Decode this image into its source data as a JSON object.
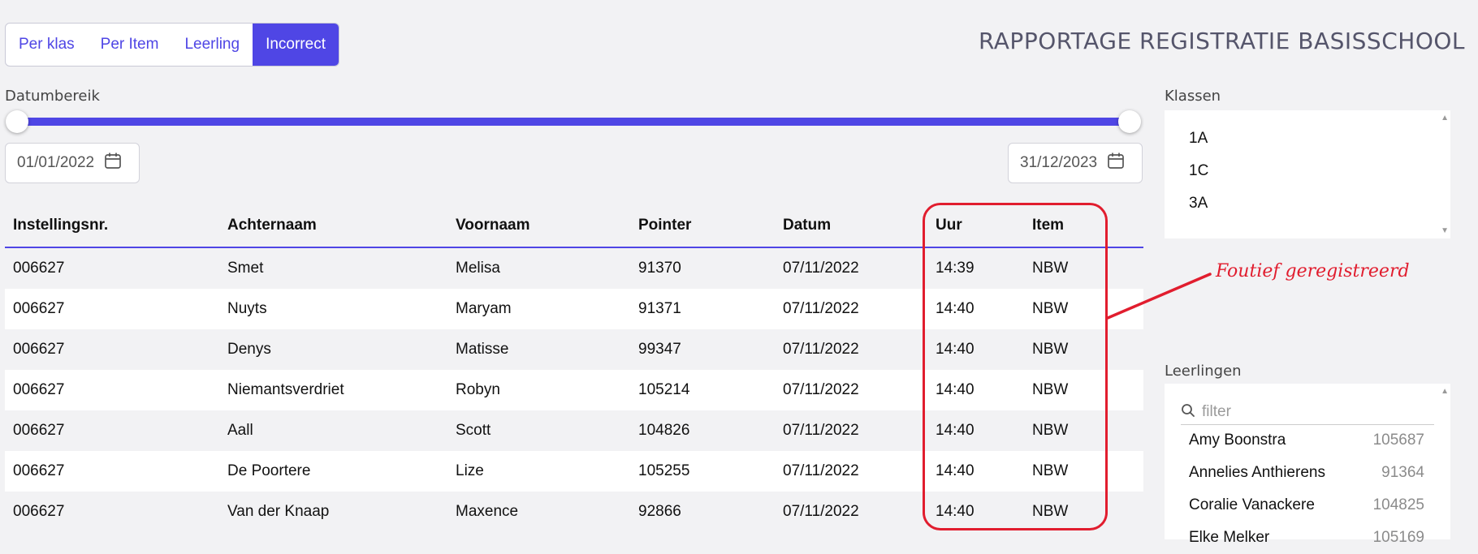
{
  "tabs": [
    {
      "label": "Per klas"
    },
    {
      "label": "Per Item"
    },
    {
      "label": "Leerling"
    },
    {
      "label": "Incorrect",
      "active": true
    }
  ],
  "app_title": "RAPPORTAGE REGISTRATIE BASISSCHOOL",
  "date_range": {
    "label": "Datumbereik",
    "start": "01/01/2022",
    "end": "31/12/2023"
  },
  "table": {
    "headers": [
      "Instellingsnr.",
      "Achternaam",
      "Voornaam",
      "Pointer",
      "Datum",
      "Uur",
      "Item"
    ],
    "rows": [
      [
        "006627",
        "Smet",
        "Melisa",
        "91370",
        "07/11/2022",
        "14:39",
        "NBW"
      ],
      [
        "006627",
        "Nuyts",
        "Maryam",
        "91371",
        "07/11/2022",
        "14:40",
        "NBW"
      ],
      [
        "006627",
        "Denys",
        "Matisse",
        "99347",
        "07/11/2022",
        "14:40",
        "NBW"
      ],
      [
        "006627",
        "Niemantsverdriet",
        "Robyn",
        "105214",
        "07/11/2022",
        "14:40",
        "NBW"
      ],
      [
        "006627",
        "Aall",
        "Scott",
        "104826",
        "07/11/2022",
        "14:40",
        "NBW"
      ],
      [
        "006627",
        "De Poortere",
        "Lize",
        "105255",
        "07/11/2022",
        "14:40",
        "NBW"
      ],
      [
        "006627",
        "Van der Knaap",
        "Maxence",
        "92866",
        "07/11/2022",
        "14:40",
        "NBW"
      ]
    ]
  },
  "klassen": {
    "label": "Klassen",
    "items": [
      "1A",
      "1C",
      "3A"
    ]
  },
  "annotation": {
    "text": "Foutief geregistreerd",
    "color": "#e11d2e"
  },
  "leerlingen": {
    "label": "Leerlingen",
    "filter_placeholder": "filter",
    "items": [
      {
        "name": "Amy Boonstra",
        "id": "105687"
      },
      {
        "name": "Annelies Anthierens",
        "id": "91364"
      },
      {
        "name": "Coralie Vanackere",
        "id": "104825"
      },
      {
        "name": "Elke Melker",
        "id": "105169"
      }
    ]
  },
  "colors": {
    "accent": "#4f46e5",
    "annotation": "#e11d2e"
  }
}
